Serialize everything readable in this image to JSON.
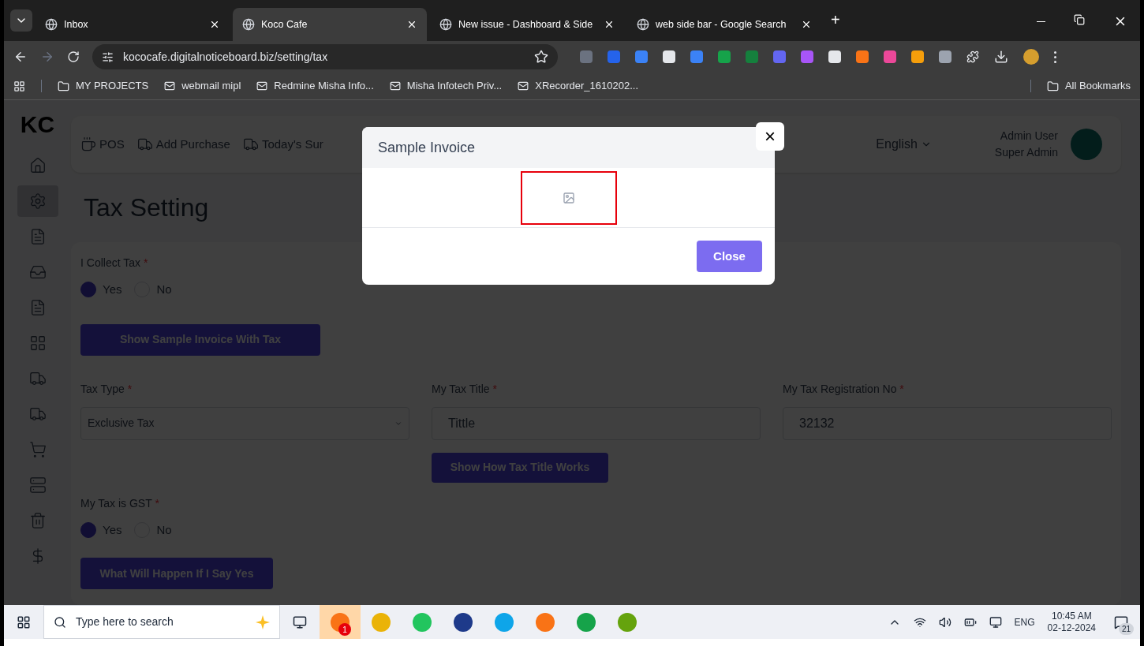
{
  "browser": {
    "tabs": [
      {
        "title": "Inbox",
        "selected": false
      },
      {
        "title": "Koco Cafe",
        "selected": true
      },
      {
        "title": "New issue - Dashboard & Side",
        "selected": false
      },
      {
        "title": "web side bar - Google Search",
        "selected": false
      }
    ],
    "new_tab": "+",
    "url": "kococafe.digitalnoticeboard.biz/setting/tax",
    "bookmarks": [
      "MY PROJECTS",
      "webmail mipl",
      "Redmine Misha Info...",
      "Misha Infotech Priv...",
      "XRecorder_1610202..."
    ],
    "all_bookmarks": "All Bookmarks"
  },
  "app": {
    "logo": "KC",
    "sidebar": [
      {
        "selected": false
      },
      {
        "selected": true
      },
      {
        "selected": false
      },
      {
        "selected": false
      },
      {
        "selected": false
      },
      {
        "selected": false
      },
      {
        "selected": false
      },
      {
        "selected": false
      },
      {
        "selected": false
      },
      {
        "selected": false
      },
      {
        "selected": false
      },
      {
        "selected": false
      }
    ],
    "topnav": [
      {
        "label": "POS"
      },
      {
        "label": "Add Purchase"
      },
      {
        "label": "Today's Sur"
      }
    ],
    "language": "English",
    "user": {
      "name": "Admin User",
      "role": "Super Admin"
    },
    "page_title": "Tax Setting",
    "collect_tax": {
      "label": "I Collect Tax",
      "required": "*",
      "options": [
        {
          "label": "Yes",
          "selected": true
        },
        {
          "label": "No",
          "selected": false
        }
      ]
    },
    "sample_button": "Show Sample Invoice With Tax",
    "tax_type": {
      "label": "Tax Type",
      "required": "*",
      "value": "Exclusive Tax"
    },
    "tax_title": {
      "label": "My Tax Title",
      "required": "*",
      "value": "Tittle"
    },
    "tax_title_button": "Show How Tax Title Works",
    "tax_reg": {
      "label": "My Tax Registration No",
      "required": "*",
      "value": "32132"
    },
    "gst": {
      "label": "My Tax is GST",
      "required": "*",
      "options": [
        {
          "label": "Yes",
          "selected": true
        },
        {
          "label": "No",
          "selected": false
        }
      ]
    },
    "gst_button": "What Will Happen If I Say Yes"
  },
  "modal": {
    "title": "Sample Invoice",
    "close_x": "×",
    "close_button": "Close"
  },
  "taskbar": {
    "search_placeholder": "Type here to search",
    "skype_badge": "1",
    "language": "ENG",
    "time": "10:45 AM",
    "date": "02-12-2024",
    "notifications": "21"
  }
}
